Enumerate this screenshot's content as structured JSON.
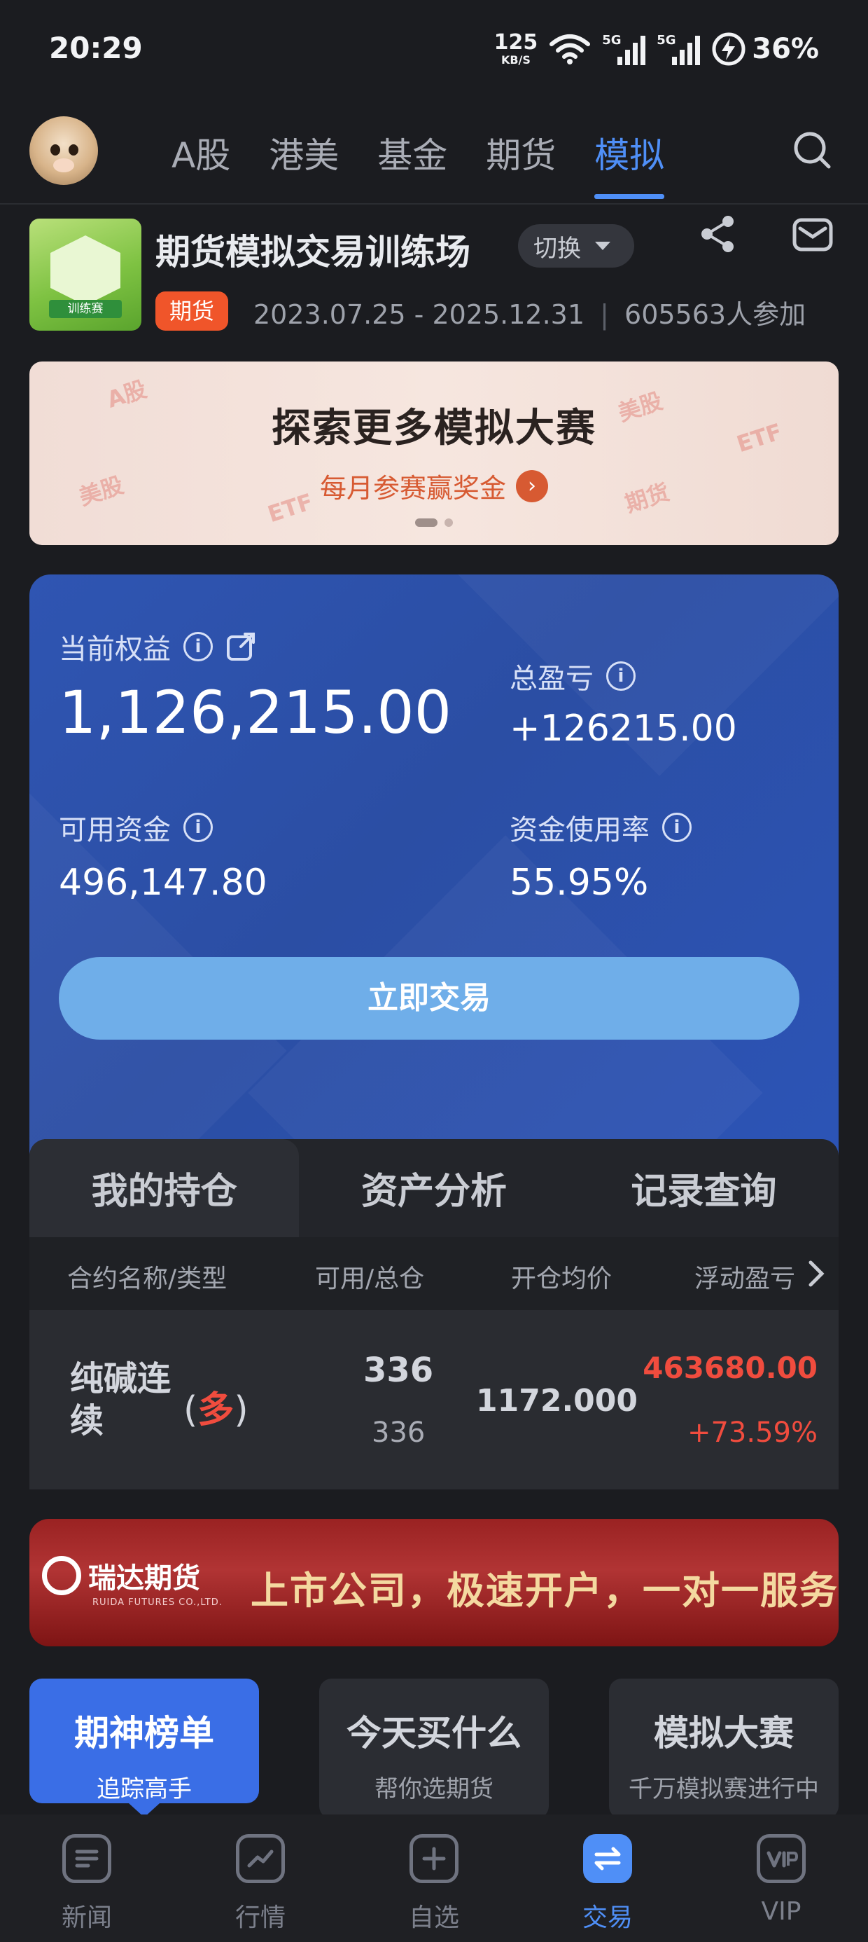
{
  "status_bar": {
    "time": "20:29",
    "net_speed": "125",
    "net_unit": "KB/S",
    "signal_1": "5G",
    "signal_2": "5G",
    "battery": "36%"
  },
  "top_nav": {
    "tabs": [
      {
        "label": "A股",
        "active": false
      },
      {
        "label": "港美",
        "active": false
      },
      {
        "label": "基金",
        "active": false
      },
      {
        "label": "期货",
        "active": false
      },
      {
        "label": "模拟",
        "active": true
      }
    ],
    "search_icon": "search-icon"
  },
  "contest": {
    "logo_ribbon": "训练赛",
    "title": "期货模拟交易训练场",
    "switch_label": "切换",
    "tag": "期货",
    "dates": "2023.07.25 - 2025.12.31",
    "participants": "605563人参加"
  },
  "banner": {
    "title": "探索更多模拟大赛",
    "subtitle": "每月参赛赢奖金",
    "watermarks": [
      "A股",
      "美股",
      "ETF",
      "美股",
      "ETF",
      "期货"
    ]
  },
  "account": {
    "equity_label": "当前权益",
    "equity_value": "1,126,215.00",
    "total_pnl_label": "总盈亏",
    "total_pnl_value": "+126215.00",
    "available_label": "可用资金",
    "available_value": "496,147.80",
    "usage_label": "资金使用率",
    "usage_value": "55.95%",
    "trade_button": "立即交易"
  },
  "positions": {
    "tabs": [
      "我的持仓",
      "资产分析",
      "记录查询"
    ],
    "columns": [
      "合约名称/类型",
      "可用/总仓",
      "开仓均价",
      "浮动盈亏"
    ],
    "rows": [
      {
        "contract": "纯碱连续",
        "side": "多",
        "available": "336",
        "total": "336",
        "open_avg_price": "1172.000",
        "floating_pnl": "463680.00",
        "floating_pnl_pct": "+73.59%"
      }
    ]
  },
  "ad": {
    "brand": "瑞达期货",
    "brand_en": "RUIDA FUTURES CO.,LTD.",
    "slogan": "上市公司，极速开户，一对一服务"
  },
  "quick_cards": [
    {
      "title": "期神榜单",
      "subtitle": "追踪高手",
      "active": true
    },
    {
      "title": "今天买什么",
      "subtitle": "帮你选期货",
      "active": false
    },
    {
      "title": "模拟大赛",
      "subtitle": "千万模拟赛进行中",
      "active": false
    }
  ],
  "bottom_nav": [
    {
      "label": "新闻",
      "icon": "news-icon",
      "active": false
    },
    {
      "label": "行情",
      "icon": "chart-icon",
      "active": false
    },
    {
      "label": "自选",
      "icon": "add-icon",
      "active": false
    },
    {
      "label": "交易",
      "icon": "exchange-icon",
      "active": true
    },
    {
      "label": "VIP",
      "icon": "vip-icon",
      "active": false
    }
  ],
  "colors": {
    "background": "#1b1c20",
    "accent_blue": "#4f8ff7",
    "card_blue": "#2f55b2",
    "profit_red": "#f04c3e",
    "tag_orange": "#f0552a"
  }
}
